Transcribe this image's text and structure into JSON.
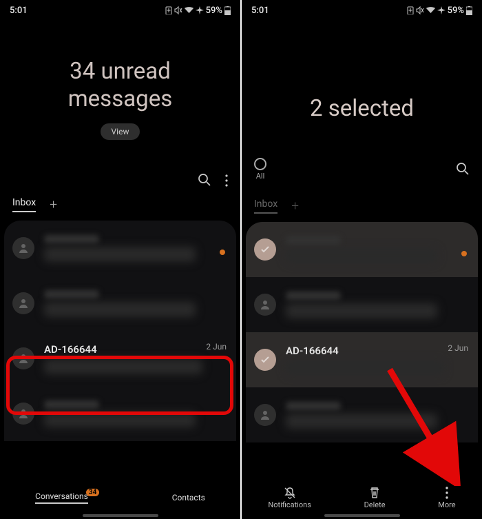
{
  "status": {
    "time": "5:01",
    "battery": "59%"
  },
  "left": {
    "header_line1": "34 unread",
    "header_line2": "messages",
    "view_btn": "View",
    "tab_inbox": "Inbox",
    "items": [
      {
        "sender": "",
        "date": "",
        "unread": true
      },
      {
        "sender": "",
        "date": "",
        "unread": false
      },
      {
        "sender": "AD-166644",
        "date": "2 Jun",
        "unread": false
      },
      {
        "sender": "",
        "date": "",
        "unread": false
      }
    ],
    "nav": {
      "conversations": "Conversations",
      "badge": "34",
      "contacts": "Contacts"
    }
  },
  "right": {
    "header": "2 selected",
    "all_label": "All",
    "tab_inbox": "Inbox",
    "items": [
      {
        "sender": "",
        "date": "",
        "selected": true,
        "unread": true
      },
      {
        "sender": "",
        "date": "",
        "selected": false
      },
      {
        "sender": "AD-166644",
        "date": "2 Jun",
        "selected": true
      },
      {
        "sender": "",
        "date": "",
        "selected": false
      }
    ],
    "actions": {
      "notifications": "Notifications",
      "delete": "Delete",
      "more": "More"
    }
  }
}
